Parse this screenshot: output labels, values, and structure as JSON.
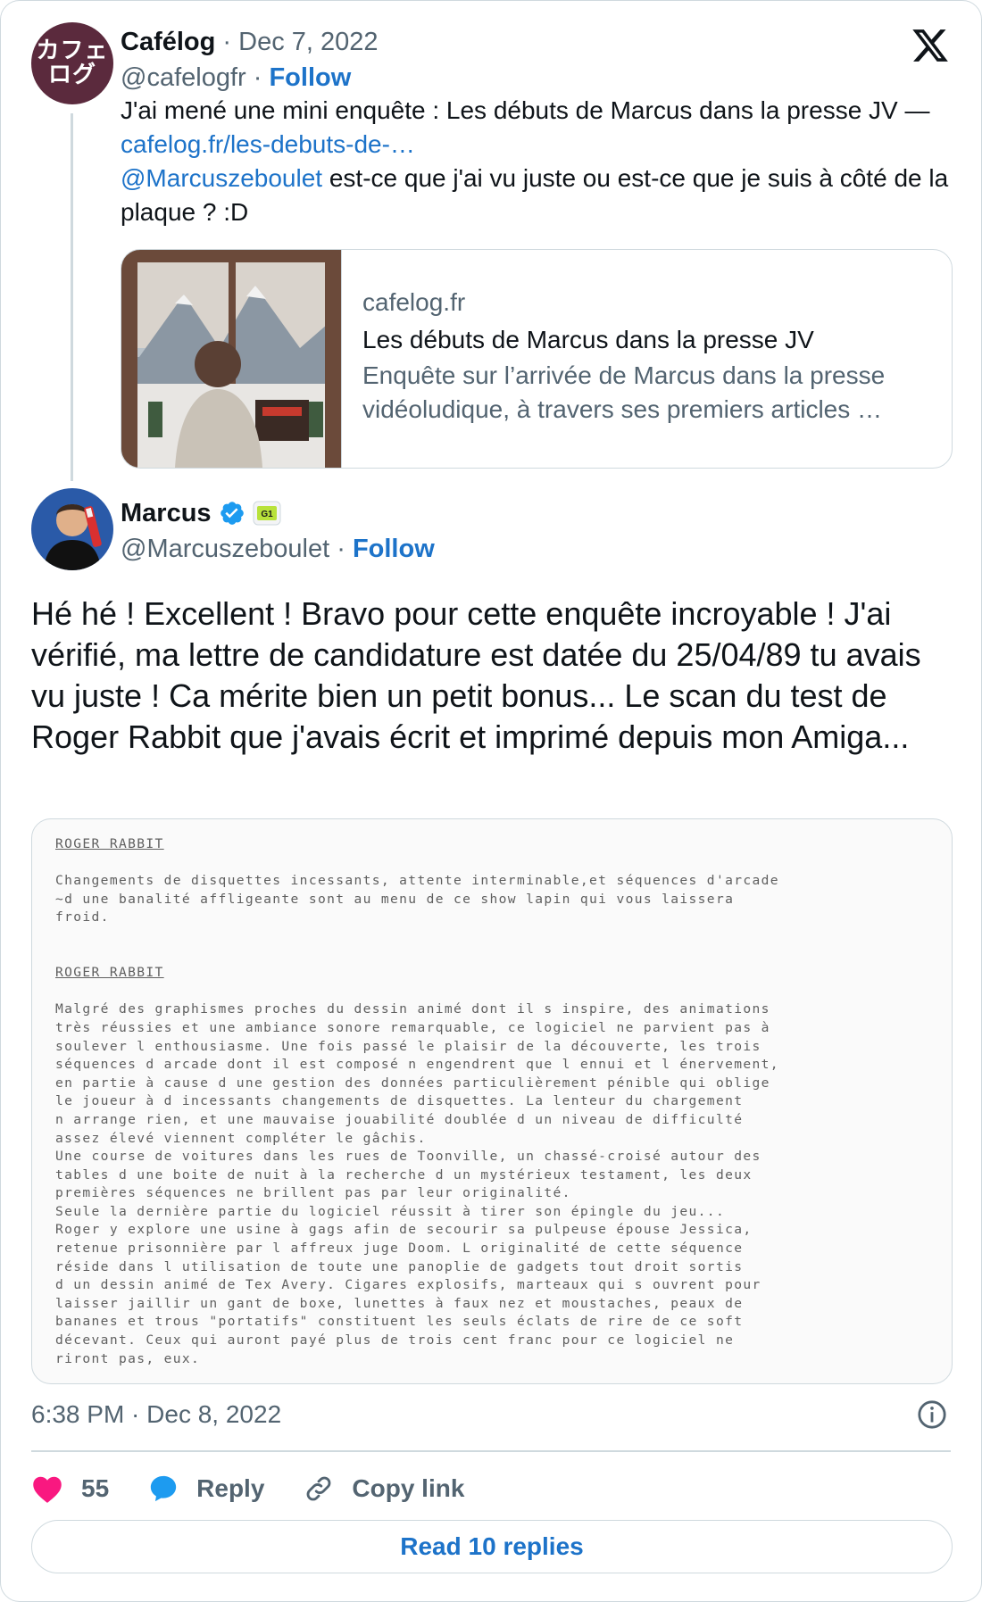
{
  "quoted_tweet": {
    "avatar_text_line1": "カフェ",
    "avatar_text_line2": "ログ",
    "name": "Cafélog",
    "date": "Dec 7, 2022",
    "handle": "@cafelogfr",
    "follow_label": "Follow",
    "text_line1": "J'ai mené une mini enquête : Les débuts de Marcus dans la presse JV —",
    "link": "cafelog.fr/les-debuts-de-…",
    "mention": "@Marcuszeboulet",
    "text_rest": " est-ce que j'ai vu juste ou est-ce que je suis à côté de la plaque ? :D",
    "link_card": {
      "domain": "cafelog.fr",
      "title": "Les débuts de Marcus dans la presse JV",
      "description": "Enquête sur l’arrivée de Marcus dans la presse vidéoludique, à travers ses premiers articles …"
    }
  },
  "main_tweet": {
    "name": "Marcus",
    "badge_label": "G1",
    "handle": "@Marcuszeboulet",
    "follow_label": "Follow",
    "text": "Hé hé ! Excellent ! Bravo pour cette enquête incroyable !  J'ai vérifié, ma lettre de candidature est datée du 25/04/89 tu avais vu juste ! Ca mérite bien un petit bonus... Le scan du test de Roger Rabbit que j'avais écrit et imprimé depuis mon Amiga...",
    "scan": {
      "heading1": "ROGER RABBIT",
      "block1": [
        "Changements de disquettes incessants, attente interminable,et séquences d'arcade",
        "~d une banalité affligeante sont au menu de ce show lapin qui vous laissera",
        " froid."
      ],
      "heading2": "ROGER RABBIT",
      "block2": [
        "Malgré des graphismes proches du dessin animé dont il s inspire, des animations",
        "très réussies et une ambiance sonore remarquable, ce logiciel ne parvient pas à",
        "soulever l enthousiasme. Une fois passé le plaisir de la découverte, les trois",
        "séquences d arcade dont il est composé n engendrent que l ennui et l énervement,",
        "en partie à cause d une gestion des données particulièrement pénible qui oblige",
        "le joueur à d incessants changements de disquettes. La lenteur du chargement",
        "n arrange rien, et une mauvaise jouabilité doublée d un niveau de difficulté",
        "assez élevé viennent compléter le gâchis.",
        "Une course de voitures dans les rues de Toonville, un chassé-croisé autour des",
        "tables d une boite de nuit à la recherche d un mystérieux testament, les deux",
        "premières séquences ne brillent pas par leur originalité.",
        "Seule la dernière partie du logiciel réussit à tirer son épingle du jeu...",
        "Roger y explore une usine à gags afin de secourir sa pulpeuse  épouse Jessica,",
        "retenue prisonnière par l affreux juge Doom. L originalité de cette séquence",
        "réside dans l utilisation de toute une panoplie de gadgets tout droit sortis",
        "d un dessin animé de Tex Avery. Cigares explosifs, marteaux qui s ouvrent pour",
        "laisser jaillir un gant de boxe, lunettes à faux nez et moustaches, peaux de",
        "bananes et trous \"portatifs\" constituent les seuls éclats de rire de ce soft",
        "décevant. Ceux qui auront payé plus de trois cent franc pour ce logiciel ne",
        "riront pas, eux."
      ]
    },
    "timestamp": "6:38 PM · Dec 8, 2022",
    "likes": "55",
    "reply_label": "Reply",
    "copy_link_label": "Copy link",
    "read_replies_label": "Read 10 replies"
  },
  "colors": {
    "link_blue": "#1d73c9",
    "muted_gray": "#536471",
    "heart_pink": "#f91880",
    "verified_blue": "#1d9bf0",
    "border": "#cfd9de"
  },
  "icons": [
    "x-logo-icon",
    "verified-badge-icon",
    "info-icon",
    "heart-icon",
    "reply-bubble-icon",
    "link-icon"
  ]
}
